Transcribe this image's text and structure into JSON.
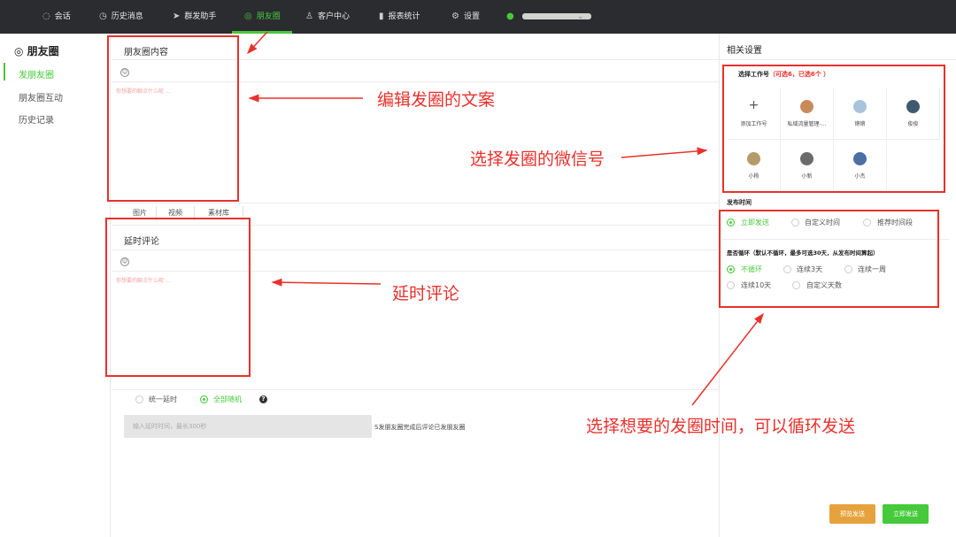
{
  "topnav": {
    "items": [
      {
        "label": "会话",
        "icon": "chat-icon"
      },
      {
        "label": "历史消息",
        "icon": "clock-icon"
      },
      {
        "label": "群发助手",
        "icon": "send-icon"
      },
      {
        "label": "朋友圈",
        "icon": "moments-icon"
      },
      {
        "label": "客户中心",
        "icon": "user-icon"
      },
      {
        "label": "报表统计",
        "icon": "bar-chart-icon"
      },
      {
        "label": "设置",
        "icon": "gear-icon"
      }
    ],
    "active_index": 3,
    "accent_color": "#46c93a"
  },
  "sidebar": {
    "title": "朋友圈",
    "items": [
      "发朋友圈",
      "朋友圈互动",
      "历史记录"
    ],
    "active_index": 0
  },
  "editor": {
    "content_title": "朋友圈内容",
    "content_placeholder": "你想要的聊点什么呢 ...",
    "tools": [
      "图片",
      "视频",
      "素材库"
    ],
    "comment_title": "延时评论",
    "comment_placeholder": "你想要的聊点什么呢 ...",
    "delay_options": [
      "统一延时",
      "全部随机"
    ],
    "delay_selected": 1,
    "delay_input_placeholder": "输入延时时间，最长300秒",
    "delay_note": "S发朋友圈完成后评论已发朋友圈"
  },
  "settings": {
    "title": "相关设置",
    "account_label": "选择工作号",
    "account_hint": "（可选6，已选6个 ）",
    "add_account": "添加工作号",
    "accounts": [
      {
        "name": "私域流量管理-...",
        "color": "#c98a5a"
      },
      {
        "name": "锵锵",
        "color": "#a9c3dd"
      },
      {
        "name": "俊俊",
        "color": "#3f5a6e"
      },
      {
        "name": "小杨",
        "color": "#b59a6a"
      },
      {
        "name": "小新",
        "color": "#6b6b6b"
      },
      {
        "name": "小杰",
        "color": "#4a6fa5"
      }
    ],
    "publish_time_label": "发布时间",
    "publish_options": [
      "立即发送",
      "自定义时间",
      "推荐时间段"
    ],
    "publish_selected": 0,
    "loop_label": "是否循环（默认不循环，最多可选30天，从发布时间算起）",
    "loop_options": [
      "不循环",
      "连续3天",
      "连续一周",
      "连续10天",
      "自定义天数"
    ],
    "loop_selected": 0,
    "btn_schedule": "预览发送",
    "btn_send": "立即发送",
    "btn_schedule_color": "#e6a23c",
    "btn_send_color": "#46c93a"
  },
  "annotations": {
    "edit_text": "编辑发圈的文案",
    "choose_wechat": "选择发圈的微信号",
    "delay_comment": "延时评论",
    "choose_time": "选择想要的发圈时间，可以循环发送",
    "color": "#e8312c"
  }
}
